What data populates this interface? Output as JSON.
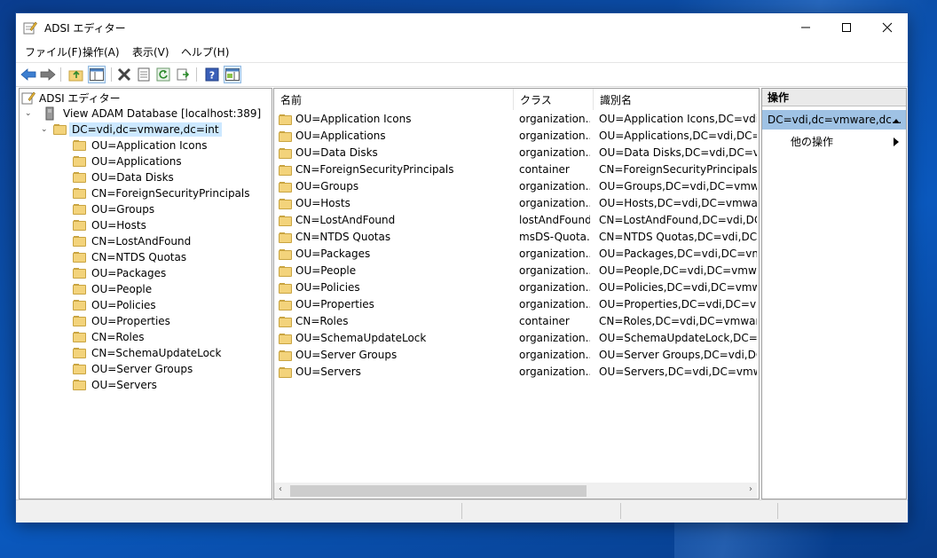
{
  "window": {
    "title": "ADSI エディター"
  },
  "menu": [
    "ファイル(F)",
    "操作(A)",
    "表示(V)",
    "ヘルプ(H)"
  ],
  "tree": {
    "root": "ADSI エディター",
    "connection": "View ADAM Database [localhost:389]",
    "selected": "DC=vdi,dc=vmware,dc=int",
    "children": [
      "OU=Application Icons",
      "OU=Applications",
      "OU=Data Disks",
      "CN=ForeignSecurityPrincipals",
      "OU=Groups",
      "OU=Hosts",
      "CN=LostAndFound",
      "CN=NTDS Quotas",
      "OU=Packages",
      "OU=People",
      "OU=Policies",
      "OU=Properties",
      "CN=Roles",
      "CN=SchemaUpdateLock",
      "OU=Server Groups",
      "OU=Servers"
    ]
  },
  "list": {
    "columns": [
      "名前",
      "クラス",
      "識別名"
    ],
    "rows": [
      {
        "name": "OU=Application Icons",
        "class": "organization...",
        "dn": "OU=Application Icons,DC=vdi,DC=vmw"
      },
      {
        "name": "OU=Applications",
        "class": "organization...",
        "dn": "OU=Applications,DC=vdi,DC=vmw"
      },
      {
        "name": "OU=Data Disks",
        "class": "organization...",
        "dn": "OU=Data Disks,DC=vdi,DC=vmwa"
      },
      {
        "name": "CN=ForeignSecurityPrincipals",
        "class": "container",
        "dn": "CN=ForeignSecurityPrincipals,DC="
      },
      {
        "name": "OU=Groups",
        "class": "organization...",
        "dn": "OU=Groups,DC=vdi,DC=vmware,D"
      },
      {
        "name": "OU=Hosts",
        "class": "organization...",
        "dn": "OU=Hosts,DC=vdi,DC=vmware,DC"
      },
      {
        "name": "CN=LostAndFound",
        "class": "lostAndFound",
        "dn": "CN=LostAndFound,DC=vdi,DC=vi"
      },
      {
        "name": "CN=NTDS Quotas",
        "class": "msDS-Quota...",
        "dn": "CN=NTDS Quotas,DC=vdi,DC=vm"
      },
      {
        "name": "OU=Packages",
        "class": "organization...",
        "dn": "OU=Packages,DC=vdi,DC=vmware"
      },
      {
        "name": "OU=People",
        "class": "organization...",
        "dn": "OU=People,DC=vdi,DC=vmware,D"
      },
      {
        "name": "OU=Policies",
        "class": "organization...",
        "dn": "OU=Policies,DC=vdi,DC=vmware,"
      },
      {
        "name": "OU=Properties",
        "class": "organization...",
        "dn": "OU=Properties,DC=vdi,DC=vmwa"
      },
      {
        "name": "CN=Roles",
        "class": "container",
        "dn": "CN=Roles,DC=vdi,DC=vmware,DC"
      },
      {
        "name": "OU=SchemaUpdateLock",
        "class": "organization...",
        "dn": "OU=SchemaUpdateLock,DC=vdi,D"
      },
      {
        "name": "OU=Server Groups",
        "class": "organization...",
        "dn": "OU=Server Groups,DC=vdi,DC=vn"
      },
      {
        "name": "OU=Servers",
        "class": "organization...",
        "dn": "OU=Servers,DC=vdi,DC=vmware,D"
      }
    ]
  },
  "actions": {
    "header": "操作",
    "selected": "DC=vdi,dc=vmware,dc...",
    "more": "他の操作"
  },
  "colors": {
    "selection": "#cce8ff",
    "action_selection": "#9fc2e4"
  }
}
